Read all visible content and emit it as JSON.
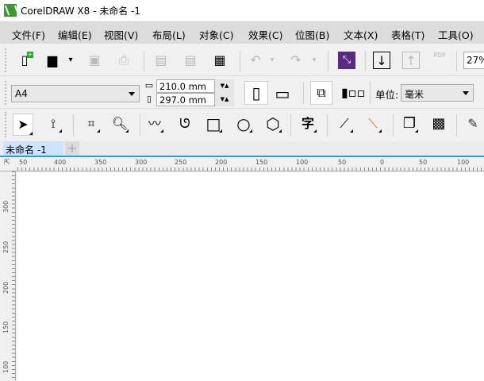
{
  "window": {
    "title": "CorelDRAW X8 - 未命名 -1"
  },
  "menu": [
    "文件(F)",
    "编辑(E)",
    "视图(V)",
    "布局(L)",
    "对象(C)",
    "效果(C)",
    "位图(B)",
    "文本(X)",
    "表格(T)",
    "工具(O)"
  ],
  "toolbar": {
    "zoom_value": "27%",
    "pdf_label": "PDF",
    "icons": [
      "new-document-icon",
      "open-folder-icon",
      "save-icon",
      "print-icon",
      "cut-icon",
      "copy-icon",
      "paste-icon",
      "undo-icon",
      "redo-icon",
      "corel-connect-icon",
      "import-icon",
      "export-icon",
      "publish-pdf-icon"
    ]
  },
  "property_bar": {
    "page_size": "A4",
    "width": "210.0 mm",
    "height": "297.0 mm",
    "unit_label": "单位:",
    "unit_value": "毫米"
  },
  "tools": [
    "pick-tool",
    "shape-tool",
    "crop-tool",
    "zoom-tool",
    "freehand-tool",
    "artistic-media-tool",
    "rectangle-tool",
    "ellipse-tool",
    "polygon-tool",
    "text-tool",
    "dimension-tool",
    "connector-tool",
    "drop-shadow-tool",
    "transparency-tool",
    "eyedropper-tool"
  ],
  "doc_tabs": {
    "active": "未命名 -1",
    "add": "+"
  },
  "rulers": {
    "horizontal": [
      "50",
      "400",
      "350",
      "300",
      "250",
      "200",
      "150",
      "100",
      "50",
      "0",
      "50",
      "100"
    ],
    "vertical": [
      "300",
      "250",
      "200",
      "150",
      "100"
    ]
  }
}
